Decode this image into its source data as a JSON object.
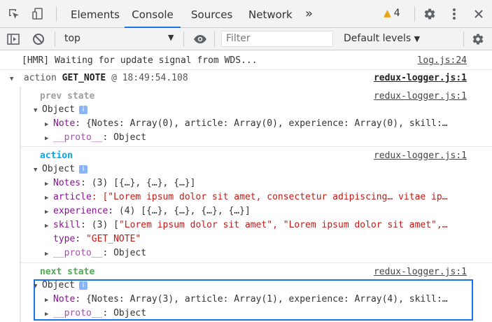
{
  "tabs": {
    "items": [
      {
        "label": "Elements"
      },
      {
        "label": "Console"
      },
      {
        "label": "Sources"
      },
      {
        "label": "Network"
      }
    ],
    "more_label": "»",
    "warning_count": "4"
  },
  "toolbar": {
    "context": "top",
    "filter_placeholder": "Filter",
    "levels": "Default levels"
  },
  "log": {
    "hmr_text": "[HMR] Waiting for update signal from WDS...",
    "hmr_source": "log.js:24",
    "action_prefix": "action",
    "action_type": "GET_NOTE",
    "action_time": "@ 18:49:54.108",
    "action_source": "redux-logger.js:1",
    "prev_label": "prev state",
    "prev_source": "redux-logger.js:1",
    "object_label": "Object",
    "prev_note_key": "Note",
    "prev_note_val": ": {Notes: Array(0), article: Array(0), experience: Array(0), skill:…",
    "proto_key": "__proto__",
    "proto_val": ": Object",
    "action_label": "action",
    "action_label_source": "redux-logger.js:1",
    "notes_key": "Notes",
    "notes_val": ": (3) [{…}, {…}, {…}]",
    "article_key": "article",
    "article_val": ": [\"Lorem ipsum dolor sit amet, consectetur adipiscing… vitae ip…",
    "experience_key": "experience",
    "experience_val": ": (4) [{…}, {…}, {…}, {…}]",
    "skill_key": "skill",
    "skill_val_prefix": ": (3) [",
    "skill_val_str": "\"Lorem ipsum dolor sit amet\", \"Lorem ipsum dolor sit amet\",…",
    "type_key": "type",
    "type_val": "\"GET_NOTE\"",
    "next_label": "next state",
    "next_source": "redux-logger.js:1",
    "next_note_key": "Note",
    "next_note_val": ": {Notes: Array(3), article: Array(1), experience: Array(4), skill:…"
  },
  "colors": {
    "accent": "#1a73e8",
    "prev_label": "#9e9e9e",
    "action_label": "#03a9f4",
    "next_label": "#4caf50",
    "key": "#881391",
    "string": "#c41a16"
  }
}
